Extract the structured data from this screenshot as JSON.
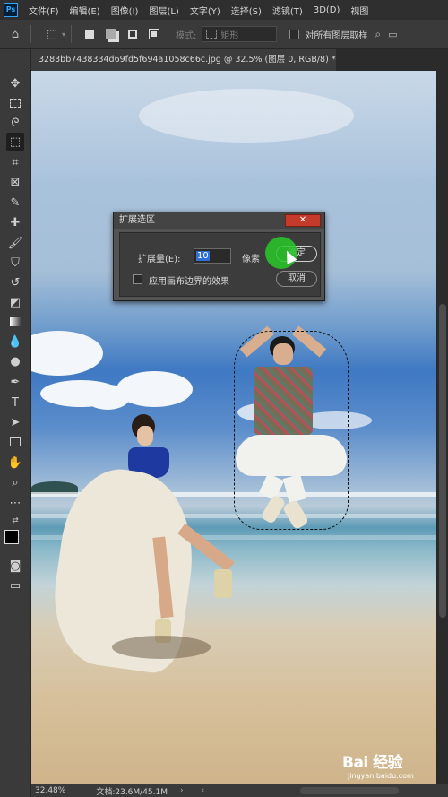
{
  "menu": {
    "app_logo": "Ps",
    "items": [
      "文件(F)",
      "编辑(E)",
      "图像(I)",
      "图层(L)",
      "文字(Y)",
      "选择(S)",
      "滤镜(T)",
      "3D(D)",
      "视图"
    ]
  },
  "options_bar": {
    "home_icon": "home-icon",
    "tool_icon": "marquee-icon",
    "style_label": "模式:",
    "style_value": "矩形",
    "sample_all_layers": "对所有图层取样"
  },
  "document": {
    "tab_title": "3283bb7438334d69fd5f694a1058c66c.jpg @ 32.5% (图层 0, RGB/8) *"
  },
  "dialog": {
    "title": "扩展选区",
    "close_label": "✕",
    "expand_label": "扩展量(E):",
    "expand_value": "10",
    "unit": "像素",
    "apply_canvas_label": "应用画布边界的效果",
    "apply_canvas_checked": false,
    "ok_label": "确定",
    "cancel_label": "取消"
  },
  "status": {
    "zoom": "32.48%",
    "doc_size": "文档:23.6M/45.1M"
  },
  "watermark": {
    "brand": "Bai 经验",
    "url": "jingyan.baidu.com"
  },
  "colors": {
    "accent": "#31a8ff",
    "close_red": "#c43a2b",
    "highlight_green": "#28c828"
  }
}
